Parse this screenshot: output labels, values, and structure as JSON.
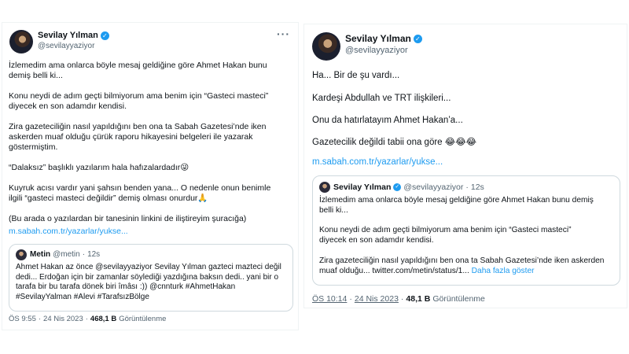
{
  "left_tweet": {
    "author": {
      "name": "Sevilay Yılman",
      "handle": "@sevilayyaziyor"
    },
    "paragraphs": [
      [
        "İzlemedim ama onlarca böyle mesaj geldiğine göre Ahmet Hakan bunu",
        "demiş belli ki..."
      ],
      [
        "Konu neydi de adım geçti bilmiyorum ama benim için “Gasteci masteci”",
        "diyecek en son adamdır kendisi."
      ],
      [
        "Zira gazeteciliğin nasıl yapıldığını ben ona ta Sabah Gazetesi’nde iken",
        "askerden muaf olduğu çürük raporu hikayesini belgeleri ile yazarak",
        "göstermiştim."
      ],
      [
        "“Dalaksız” başlıklı yazılarım hala hafızalardadır😜"
      ],
      [
        "Kuyruk acısı vardır yani şahsın benden yana... O nedenle onun benimle",
        "ilgili “gasteci masteci değildir” demiş olması onurdur🙏"
      ],
      [
        "(Bu arada o yazılardan bir tanesinin linkini de iliştireyim şuracığa)"
      ]
    ],
    "link": "m.sabah.com.tr/yazarlar/yukse...",
    "quote": {
      "name": "Metin",
      "handle": "@metin",
      "time": "12s",
      "lines": [
        "Ahmet Hakan az önce @sevilayyaziyor  Sevilay Yılman gazteci mazteci değil",
        "dedi... Erdoğan için bir zamanlar söylediği yazdığına baksın dedi.. yani bir o",
        "tarafa bir bu tarafa dönek biri îmâsı :)) @cnnturk #AhmetHakan",
        "#SevilayYalman #Alevi #TarafsızBölge"
      ]
    },
    "footer": {
      "time": "ÖS 9:55",
      "date": "24 Nis 2023",
      "views": "468,1 B",
      "views_label": "Görüntülenme"
    }
  },
  "right_tweet": {
    "author": {
      "name": "Sevilay Yılman",
      "handle": "@sevilayyaziyor"
    },
    "paragraphs": [
      "Ha... Bir de şu vardı...",
      "Kardeşi Abdullah ve TRT ilişkileri...",
      "Onu da hatırlatayım Ahmet Hakan’a...",
      "Gazetecilik değildi tabii ona göre 😂😂😂"
    ],
    "link": "m.sabah.com.tr/yazarlar/yukse...",
    "quote": {
      "name": "Sevilay Yılman",
      "handle": "@sevilayyaziyor",
      "time": "12s",
      "lines": [
        "İzlemedim ama onlarca böyle mesaj geldiğine göre Ahmet Hakan bunu demiş",
        "belli ki...",
        "",
        "Konu neydi de adım geçti bilmiyorum ama benim için “Gasteci masteci”",
        "diyecek en son adamdır kendisi.",
        "",
        "Zira gazeteciliğin nasıl yapıldığını ben ona ta Sabah Gazetesi’nde iken askerden"
      ],
      "last_line": "muaf olduğu... twitter.com/metin/status/1...",
      "show_more": "Daha fazla göster"
    },
    "footer": {
      "time": "ÖS 10:14",
      "date": "24 Nis 2023",
      "views": "48,1 B",
      "views_label": "Görüntülenme"
    }
  }
}
